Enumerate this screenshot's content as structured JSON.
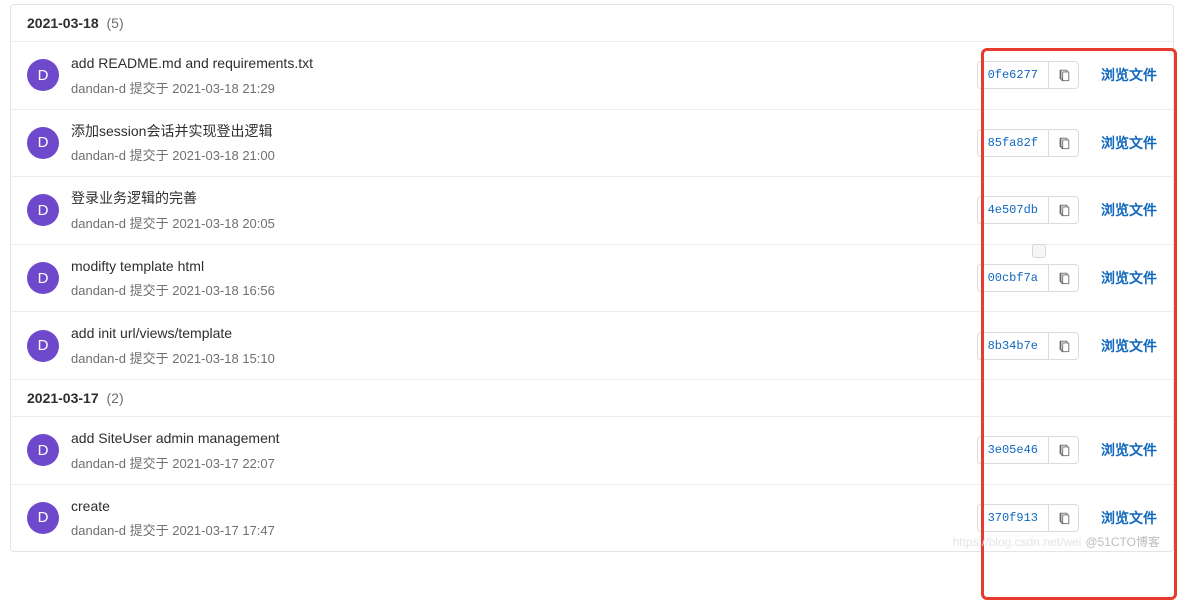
{
  "avatar_letter": "D",
  "browse_label": "浏览文件",
  "groups": [
    {
      "date": "2021-03-18",
      "count": "(5)",
      "commits": [
        {
          "title": "add README.md and requirements.txt",
          "author": "dandan-d",
          "verb": "提交于",
          "time": "2021-03-18 21:29",
          "sha": "0fe6277"
        },
        {
          "title": "添加session会话并实现登出逻辑",
          "author": "dandan-d",
          "verb": "提交于",
          "time": "2021-03-18 21:00",
          "sha": "85fa82f"
        },
        {
          "title": "登录业务逻辑的完善",
          "author": "dandan-d",
          "verb": "提交于",
          "time": "2021-03-18 20:05",
          "sha": "4e507db"
        },
        {
          "title": "modifty template html",
          "author": "dandan-d",
          "verb": "提交于",
          "time": "2021-03-18 16:56",
          "sha": "00cbf7a"
        },
        {
          "title": "add init url/views/template",
          "author": "dandan-d",
          "verb": "提交于",
          "time": "2021-03-18 15:10",
          "sha": "8b34b7e"
        }
      ]
    },
    {
      "date": "2021-03-17",
      "count": "(2)",
      "commits": [
        {
          "title": "add SiteUser admin management",
          "author": "dandan-d",
          "verb": "提交于",
          "time": "2021-03-17 22:07",
          "sha": "3e05e46"
        },
        {
          "title": "create",
          "author": "dandan-d",
          "verb": "提交于",
          "time": "2021-03-17 17:47",
          "sha": "370f913"
        }
      ]
    }
  ],
  "watermark": {
    "faint": "https://blog.csdn.net/wei",
    "text": "@51CTO博客"
  }
}
